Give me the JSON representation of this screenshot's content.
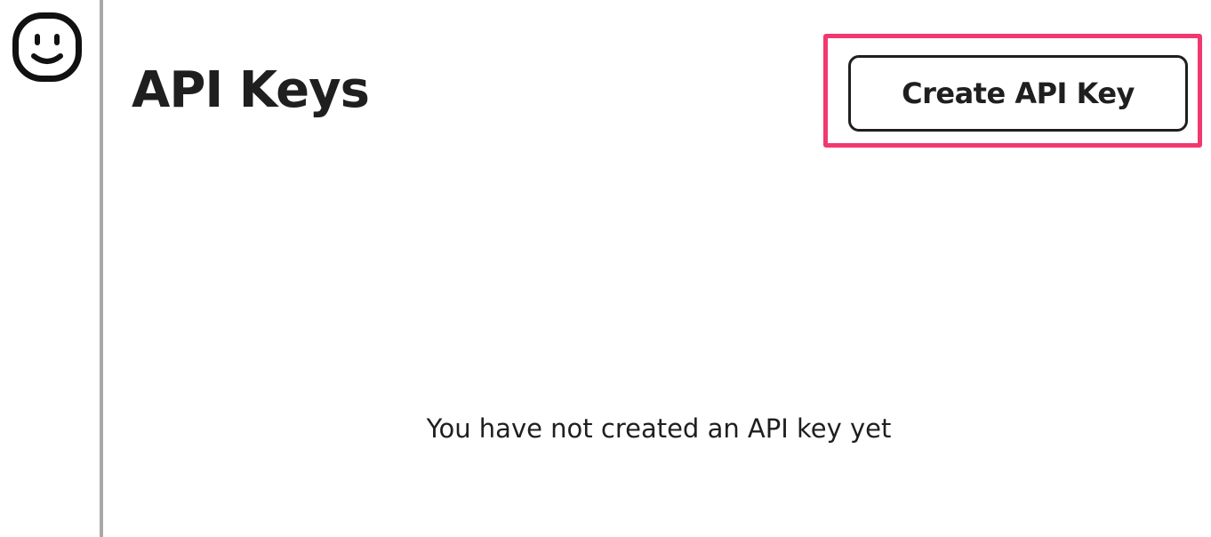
{
  "sidebar": {
    "logo_icon": "smiley-face-icon"
  },
  "header": {
    "title": "API Keys",
    "create_button_label": "Create API Key"
  },
  "empty_state": {
    "message": "You have not created an API key yet"
  },
  "colors": {
    "highlight": "#f2386f",
    "text": "#1f1f1f",
    "divider": "#a8a8a8",
    "background": "#ffffff"
  }
}
